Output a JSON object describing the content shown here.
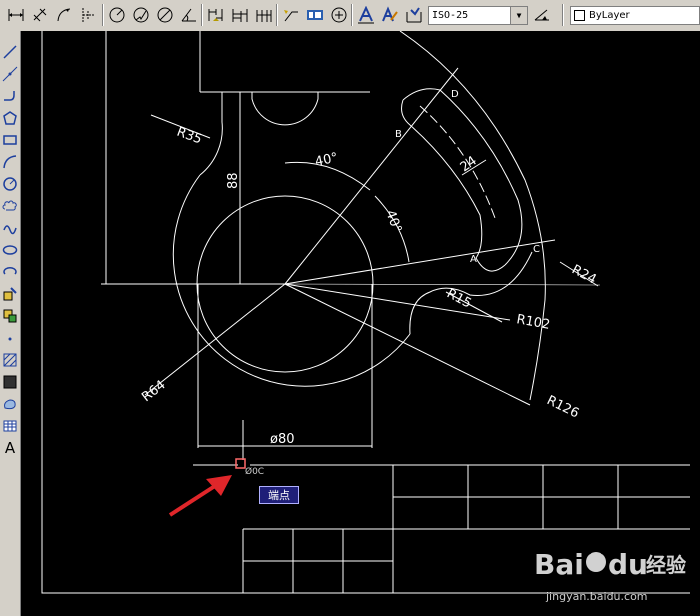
{
  "toolbar": {
    "dim_style": "ISO-25",
    "layer": "ByLayer"
  },
  "drawing": {
    "dims": {
      "r35": "R35",
      "d88": "88",
      "a40_top": "40°",
      "a40_side": "40°",
      "d24": "24",
      "r24": "R24",
      "r15": "R15",
      "r102": "R102",
      "r64": "R64",
      "r126": "R126",
      "phi80": "ø80"
    },
    "points": {
      "a": "A",
      "b": "B",
      "c": "C",
      "d": "D"
    },
    "snap_marker_text": "Ø0C",
    "snap_tooltip": "端点"
  },
  "watermark": {
    "url": "jingyan.baidu.com"
  },
  "colors": {
    "background": "#000000",
    "lines": "#ffffff",
    "arrow": "#e0262a",
    "snap_marker": "#ff6a6a",
    "tooltip_bg": "#1f1f78"
  }
}
